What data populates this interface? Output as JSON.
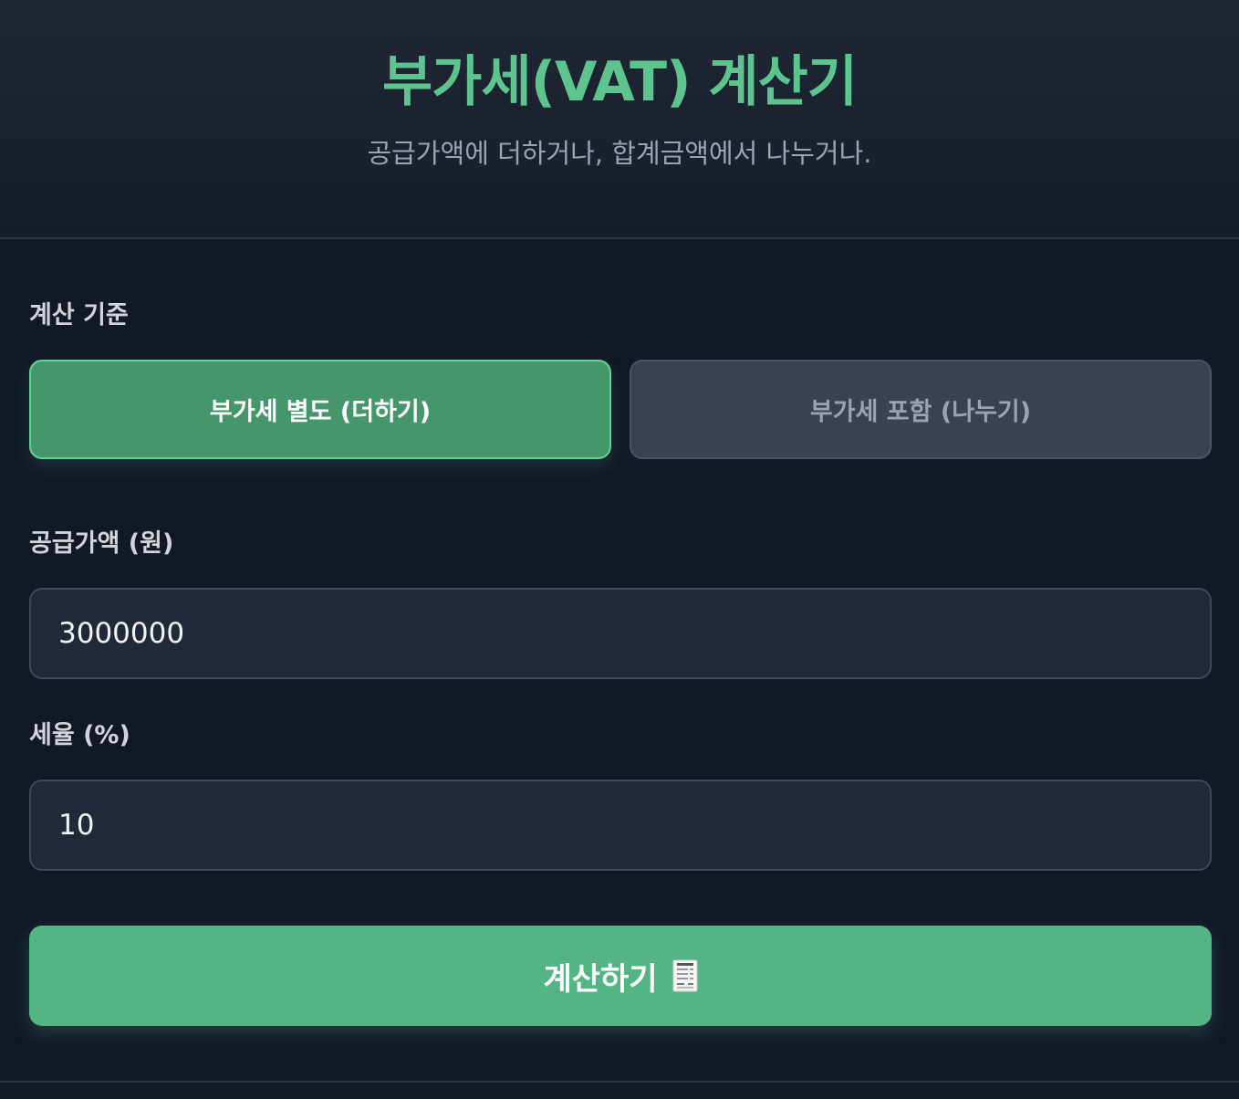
{
  "header": {
    "title": "부가세(VAT) 계산기",
    "subtitle": "공급가액에 더하거나, 합계금액에서 나누거나."
  },
  "mode": {
    "label": "계산 기준",
    "options": [
      {
        "label": "부가세 별도 (더하기)",
        "selected": true
      },
      {
        "label": "부가세 포함 (나누기)",
        "selected": false
      }
    ]
  },
  "supply": {
    "label": "공급가액 (원)",
    "value": "3000000"
  },
  "rate": {
    "label": "세율 (%)",
    "value": "10"
  },
  "calculate": {
    "label": "계산하기",
    "icon": "receipt-icon"
  },
  "colors": {
    "accent": "#5dc48e",
    "active_button": "#46966c",
    "primary_button": "#53b584",
    "background": "#121826"
  }
}
